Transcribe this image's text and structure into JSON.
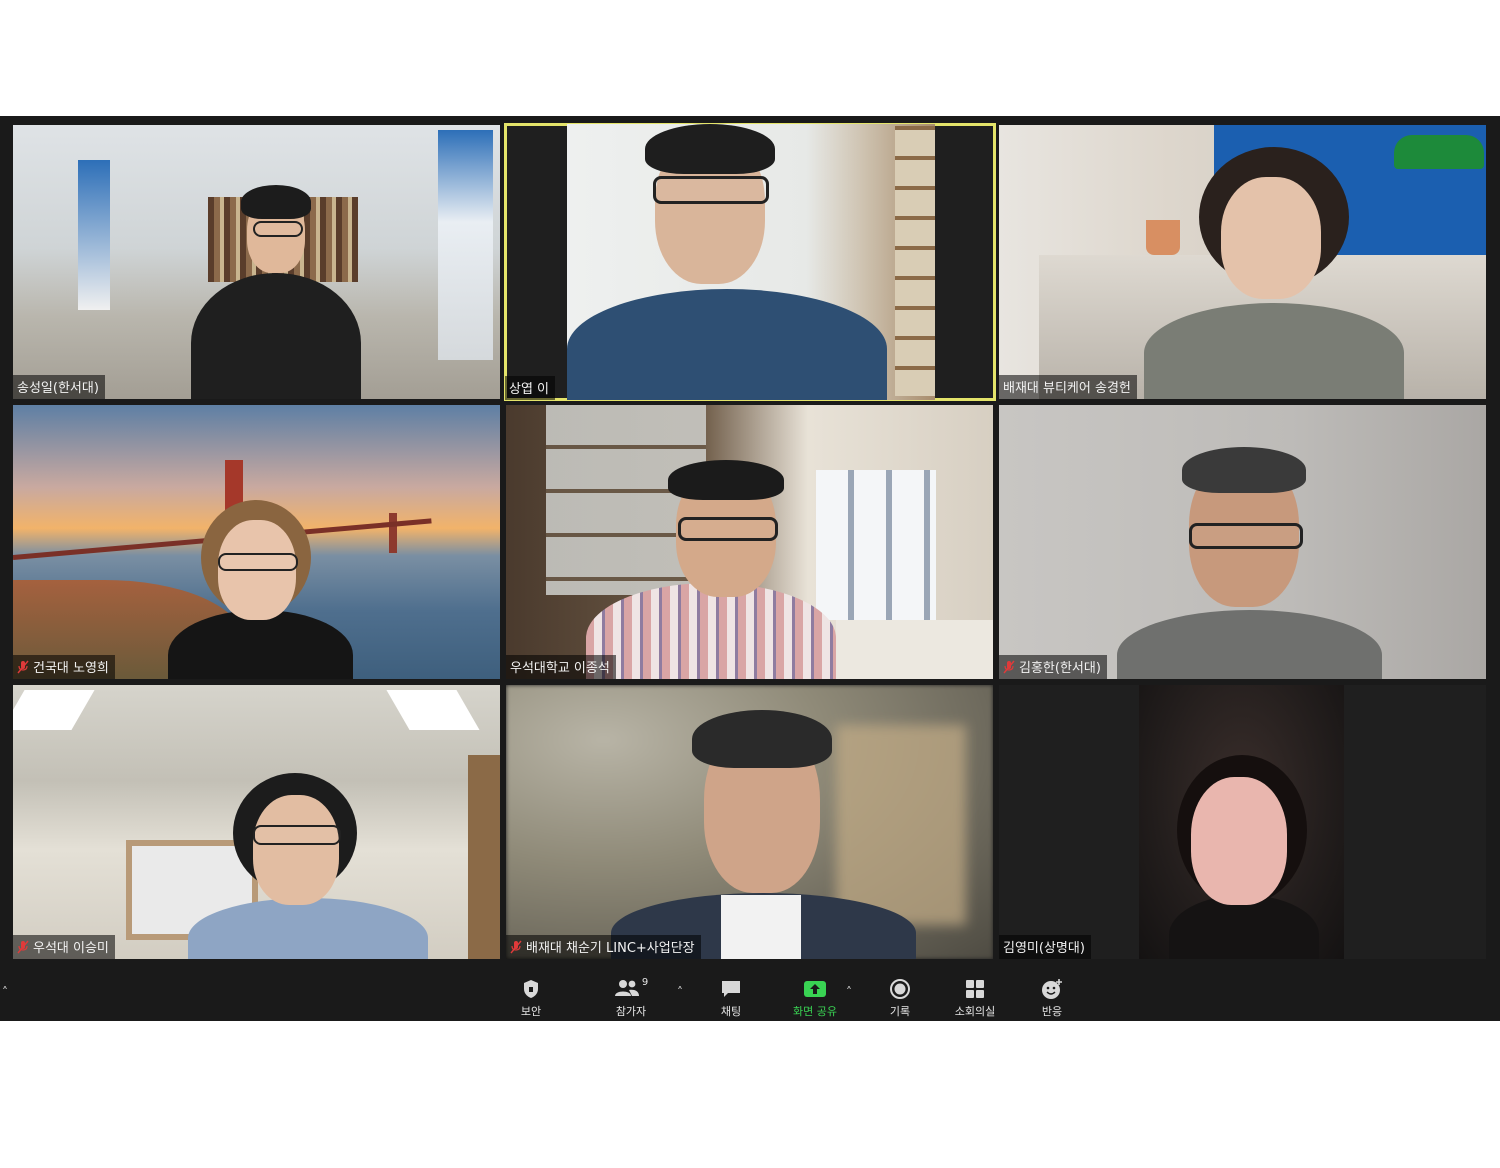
{
  "participants": [
    {
      "name": "송성일(한서대)",
      "muted": false
    },
    {
      "name": "상엽 이",
      "muted": false,
      "active_speaker": true
    },
    {
      "name": "배재대 뷰티케어 송경헌",
      "muted": false
    },
    {
      "name": "건국대 노영희",
      "muted": true
    },
    {
      "name": "우석대학교 이종석",
      "muted": false
    },
    {
      "name": "김홍한(한서대)",
      "muted": true
    },
    {
      "name": "우석대 이승미",
      "muted": true
    },
    {
      "name": "배재대 채순기 LINC+사업단장",
      "muted": true
    },
    {
      "name": "김영미(상명대)",
      "muted": false
    }
  ],
  "toolbar": {
    "security_label": "보안",
    "participants_label": "참가자",
    "participants_count": "9",
    "chat_label": "채팅",
    "share_label": "화면 공유",
    "record_label": "기록",
    "breakout_label": "소회의실",
    "reactions_label": "반응"
  },
  "colors": {
    "active_speaker_border": "#e4e46a",
    "share_green": "#39d353",
    "toolbar_bg": "#1a1a1a"
  }
}
